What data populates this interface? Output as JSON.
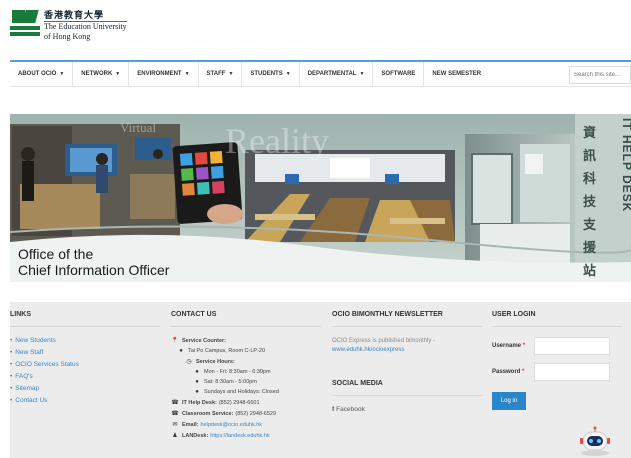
{
  "header": {
    "logo_zh": "香港教育大學",
    "logo_en_1": "The Education University",
    "logo_en_2": "of Hong Kong"
  },
  "nav": {
    "items": [
      {
        "label": "ABOUT OCIO",
        "caret": true
      },
      {
        "label": "NETWORK",
        "caret": true
      },
      {
        "label": "ENVIRONMENT",
        "caret": true
      },
      {
        "label": "STAFF",
        "caret": true
      },
      {
        "label": "STUDENTS",
        "caret": true
      },
      {
        "label": "DEPARTMENTAL",
        "caret": true
      },
      {
        "label": "SOFTWARE",
        "caret": false
      },
      {
        "label": "NEW SEMESTER",
        "caret": false
      }
    ],
    "search_placeholder": "Search this site..."
  },
  "banner": {
    "title_line1": "Office of the",
    "title_line2": "Chief Information Officer",
    "bg_word": "Reality",
    "bg_word2": "Virtual",
    "helpdesk_zh": [
      "資",
      "訊",
      "科",
      "技",
      "支",
      "援",
      "站"
    ],
    "helpdesk_en": "IT HELP DESK"
  },
  "footer": {
    "links": {
      "heading": "LINKS",
      "items": [
        "New Students",
        "New Staff",
        "OCIO Services Status",
        "FAQ's",
        "Sitemap",
        "Contact Us"
      ]
    },
    "contact": {
      "heading": "CONTACT US",
      "service_counter_label": "Service Counter:",
      "location": "Tai Po Campus, Room C-LP-20",
      "service_hours_label": "Service Hours:",
      "hours": [
        "Mon - Fri: 8:30am - 6:30pm",
        "Sat: 8:30am - 5:00pm",
        "Sundays and Holidays: Closed"
      ],
      "helpdesk_label": "IT Help Desk:",
      "helpdesk_value": "(852) 2948-6601",
      "classroom_label": "Classroom Service:",
      "classroom_value": "(852) 2948-6529",
      "email_label": "Email:",
      "email_value": "helpdesk@ocio.eduhk.hk",
      "landesk_label": "LANDesk:",
      "landesk_value": "https://landesk.eduhk.hk"
    },
    "newsletter": {
      "heading": "OCIO BIMONTHLY NEWSLETTER",
      "text": "OCIO Express is published bimonthly -",
      "link": "www.eduhk.hk/ocioexpress"
    },
    "social": {
      "heading": "SOCIAL MEDIA",
      "facebook": "Facebook"
    },
    "login": {
      "heading": "USER LOGIN",
      "username_label": "Username",
      "password_label": "Password",
      "required_mark": "*",
      "button": "Log in"
    }
  },
  "colors": {
    "brand_green": "#1a7a3a",
    "nav_accent": "#4aa3df",
    "link_blue": "#3a85c7",
    "footer_bg": "#ececec"
  }
}
